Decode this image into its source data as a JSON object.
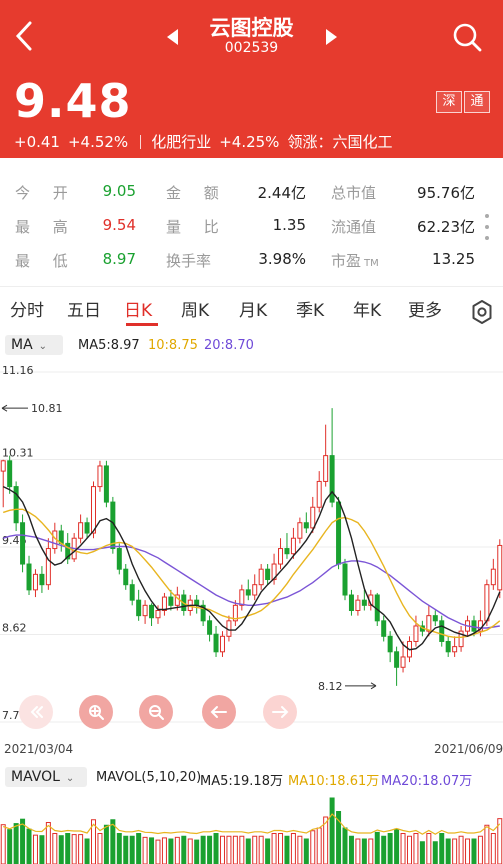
{
  "header": {
    "title": "云图控股",
    "code": "002539",
    "price": "9.48",
    "badges": [
      "深",
      "通"
    ],
    "change": "+0.41",
    "change_pct": "+4.52%",
    "industry": "化肥行业",
    "industry_pct": "+4.25%",
    "leader_label": "领涨：六国化工"
  },
  "stats": {
    "open_label": "今 开",
    "open": "9.05",
    "high_label": "最 高",
    "high": "9.54",
    "low_label": "最 低",
    "low": "8.97",
    "amount_label": "金 额",
    "amount": "2.44亿",
    "volratio_label": "量 比",
    "volratio": "1.35",
    "turnover_label": "换手率",
    "turnover": "3.98%",
    "mktcap_label": "总市值",
    "mktcap": "95.76亿",
    "float_label": "流通值",
    "float": "62.23亿",
    "pe_label": "市盈",
    "pe_suffix": "TM",
    "pe": "13.25"
  },
  "tabs": [
    "分时",
    "五日",
    "日K",
    "周K",
    "月K",
    "季K",
    "年K",
    "更多"
  ],
  "active_tab": "日K",
  "ma_legend": {
    "selector": "MA",
    "ma5": "MA5:8.97",
    "ma10": "10:8.75",
    "ma20": "20:8.70"
  },
  "chart_data": {
    "type": "candlestick",
    "x_start": "2021/03/04",
    "x_end": "2021/06/09",
    "ylim": [
      7.77,
      11.16
    ],
    "y_ticks": [
      "11.16",
      "10.31",
      "9.46",
      "8.62",
      "7.77"
    ],
    "annotations": {
      "high": "10.81",
      "low": "8.12"
    },
    "colors": {
      "up": "#e0302a",
      "down": "#1aa130",
      "ma5": "#222222",
      "ma10": "#e8b520",
      "ma20": "#7b55d6"
    },
    "candles": [
      [
        10.2,
        10.3,
        9.85,
        10.31
      ],
      [
        10.3,
        10.05,
        9.98,
        10.35
      ],
      [
        10.05,
        9.7,
        9.62,
        10.1
      ],
      [
        9.7,
        9.3,
        9.22,
        9.78
      ],
      [
        9.3,
        9.05,
        9.0,
        9.38
      ],
      [
        9.05,
        9.2,
        8.98,
        9.25
      ],
      [
        9.2,
        9.1,
        9.02,
        9.28
      ],
      [
        9.1,
        9.45,
        9.05,
        9.55
      ],
      [
        9.45,
        9.62,
        9.4,
        9.7
      ],
      [
        9.62,
        9.5,
        9.42,
        9.68
      ],
      [
        9.5,
        9.35,
        9.3,
        9.6
      ],
      [
        9.35,
        9.55,
        9.32,
        9.6
      ],
      [
        9.55,
        9.7,
        9.5,
        9.78
      ],
      [
        9.7,
        9.6,
        9.55,
        9.75
      ],
      [
        9.6,
        10.05,
        9.55,
        10.1
      ],
      [
        10.05,
        10.25,
        10.0,
        10.3
      ],
      [
        10.25,
        9.9,
        9.85,
        10.3
      ],
      [
        9.9,
        9.45,
        9.4,
        9.95
      ],
      [
        9.45,
        9.25,
        9.2,
        9.5
      ],
      [
        9.25,
        9.1,
        9.05,
        9.3
      ],
      [
        9.1,
        8.95,
        8.9,
        9.15
      ],
      [
        8.95,
        8.8,
        8.75,
        9.05
      ],
      [
        8.8,
        8.9,
        8.72,
        8.95
      ],
      [
        8.9,
        8.78,
        8.7,
        8.92
      ],
      [
        8.78,
        8.85,
        8.72,
        8.9
      ],
      [
        8.85,
        8.98,
        8.8,
        9.02
      ],
      [
        8.98,
        8.9,
        8.85,
        9.05
      ],
      [
        8.9,
        9.0,
        8.85,
        9.08
      ],
      [
        9.0,
        8.85,
        8.8,
        9.05
      ],
      [
        8.85,
        8.95,
        8.8,
        9.0
      ],
      [
        8.95,
        8.9,
        8.82,
        9.0
      ],
      [
        8.9,
        8.75,
        8.7,
        8.95
      ],
      [
        8.75,
        8.62,
        8.55,
        8.8
      ],
      [
        8.62,
        8.45,
        8.4,
        8.7
      ],
      [
        8.45,
        8.6,
        8.4,
        8.65
      ],
      [
        8.6,
        8.75,
        8.55,
        8.8
      ],
      [
        8.75,
        8.9,
        8.7,
        8.95
      ],
      [
        8.9,
        9.05,
        8.85,
        9.1
      ],
      [
        9.05,
        9.0,
        8.95,
        9.15
      ],
      [
        9.0,
        9.1,
        8.95,
        9.2
      ],
      [
        9.1,
        9.25,
        9.05,
        9.3
      ],
      [
        9.25,
        9.15,
        9.1,
        9.3
      ],
      [
        9.15,
        9.3,
        9.1,
        9.4
      ],
      [
        9.3,
        9.45,
        9.25,
        9.55
      ],
      [
        9.45,
        9.4,
        9.35,
        9.6
      ],
      [
        9.4,
        9.55,
        9.35,
        9.65
      ],
      [
        9.55,
        9.7,
        9.5,
        9.75
      ],
      [
        9.7,
        9.65,
        9.6,
        9.8
      ],
      [
        9.65,
        9.85,
        9.6,
        9.95
      ],
      [
        9.85,
        10.1,
        9.8,
        10.2
      ],
      [
        10.1,
        10.35,
        10.05,
        10.65
      ],
      [
        10.35,
        9.9,
        9.85,
        10.81
      ],
      [
        9.9,
        9.3,
        9.25,
        9.95
      ],
      [
        9.3,
        9.0,
        8.95,
        9.35
      ],
      [
        9.0,
        8.85,
        8.8,
        9.05
      ],
      [
        8.85,
        8.95,
        8.8,
        9.0
      ],
      [
        8.95,
        8.9,
        8.85,
        9.05
      ],
      [
        8.9,
        9.0,
        8.85,
        9.05
      ],
      [
        9.0,
        8.75,
        8.7,
        9.02
      ],
      [
        8.75,
        8.6,
        8.55,
        8.8
      ],
      [
        8.6,
        8.45,
        8.35,
        8.65
      ],
      [
        8.45,
        8.3,
        8.12,
        8.5
      ],
      [
        8.3,
        8.4,
        8.25,
        8.55
      ],
      [
        8.4,
        8.55,
        8.35,
        8.6
      ],
      [
        8.55,
        8.7,
        8.5,
        8.8
      ],
      [
        8.7,
        8.65,
        8.6,
        8.75
      ],
      [
        8.65,
        8.8,
        8.6,
        8.9
      ],
      [
        8.8,
        8.75,
        8.7,
        8.85
      ],
      [
        8.75,
        8.55,
        8.5,
        8.8
      ],
      [
        8.55,
        8.45,
        8.4,
        8.6
      ],
      [
        8.45,
        8.5,
        8.4,
        8.6
      ],
      [
        8.5,
        8.65,
        8.45,
        8.7
      ],
      [
        8.65,
        8.75,
        8.6,
        8.8
      ],
      [
        8.75,
        8.65,
        8.6,
        8.8
      ],
      [
        8.65,
        8.75,
        8.6,
        8.85
      ],
      [
        8.75,
        9.1,
        8.7,
        9.15
      ],
      [
        9.1,
        9.25,
        9.05,
        9.35
      ],
      [
        9.05,
        9.48,
        8.97,
        9.54
      ]
    ],
    "ma5": [
      10.05,
      10.02,
      9.98,
      9.9,
      9.76,
      9.58,
      9.45,
      9.34,
      9.29,
      9.31,
      9.37,
      9.42,
      9.48,
      9.55,
      9.62,
      9.72,
      9.74,
      9.7,
      9.6,
      9.48,
      9.3,
      9.16,
      9.04,
      8.94,
      8.86,
      8.86,
      8.87,
      8.88,
      8.89,
      8.9,
      8.9,
      8.88,
      8.84,
      8.77,
      8.7,
      8.66,
      8.66,
      8.72,
      8.82,
      8.92,
      9.03,
      9.1,
      9.16,
      9.23,
      9.3,
      9.38,
      9.45,
      9.53,
      9.63,
      9.76,
      9.92,
      10.0,
      9.92,
      9.76,
      9.55,
      9.3,
      9.06,
      8.91,
      8.86,
      8.81,
      8.74,
      8.62,
      8.52,
      8.47,
      8.48,
      8.53,
      8.62,
      8.68,
      8.7,
      8.67,
      8.64,
      8.62,
      8.6,
      8.63,
      8.67,
      8.75,
      8.88,
      9.03
    ],
    "ma10": [
      9.8,
      9.82,
      9.83,
      9.83,
      9.8,
      9.76,
      9.7,
      9.63,
      9.55,
      9.5,
      9.46,
      9.43,
      9.41,
      9.4,
      9.42,
      9.45,
      9.48,
      9.5,
      9.51,
      9.5,
      9.47,
      9.41,
      9.34,
      9.27,
      9.19,
      9.11,
      9.03,
      8.97,
      8.92,
      8.89,
      8.88,
      8.87,
      8.86,
      8.83,
      8.8,
      8.78,
      8.77,
      8.78,
      8.8,
      8.82,
      8.85,
      8.9,
      8.96,
      9.03,
      9.11,
      9.2,
      9.28,
      9.36,
      9.44,
      9.53,
      9.62,
      9.7,
      9.74,
      9.75,
      9.73,
      9.7,
      9.62,
      9.52,
      9.4,
      9.28,
      9.15,
      9.02,
      8.9,
      8.8,
      8.73,
      8.68,
      8.66,
      8.64,
      8.62,
      8.6,
      8.59,
      8.59,
      8.6,
      8.62,
      8.64,
      8.66,
      8.7,
      8.75
    ],
    "ma20": [
      9.55,
      9.57,
      9.58,
      9.58,
      9.57,
      9.56,
      9.54,
      9.52,
      9.5,
      9.48,
      9.46,
      9.45,
      9.44,
      9.44,
      9.44,
      9.45,
      9.46,
      9.47,
      9.47,
      9.47,
      9.46,
      9.44,
      9.42,
      9.39,
      9.36,
      9.32,
      9.28,
      9.24,
      9.2,
      9.16,
      9.12,
      9.08,
      9.04,
      9.0,
      8.97,
      8.94,
      8.92,
      8.91,
      8.9,
      8.9,
      8.91,
      8.92,
      8.94,
      8.96,
      8.98,
      9.01,
      9.04,
      9.08,
      9.12,
      9.17,
      9.22,
      9.27,
      9.3,
      9.32,
      9.33,
      9.33,
      9.32,
      9.3,
      9.27,
      9.23,
      9.19,
      9.14,
      9.09,
      9.04,
      8.99,
      8.94,
      8.9,
      8.86,
      8.82,
      8.78,
      8.75,
      8.72,
      8.7,
      8.69,
      8.68,
      8.68,
      8.69,
      8.7
    ]
  },
  "vol_legend": {
    "selector": "MAVOL",
    "params": "MAVOL(5,10,20)",
    "ma5": "MA5:19.18万",
    "ma10": "MA10:18.61万",
    "ma20": "MA20:18.07万"
  },
  "controls": [
    "fast-back",
    "zoom-in",
    "zoom-out",
    "left",
    "right"
  ]
}
